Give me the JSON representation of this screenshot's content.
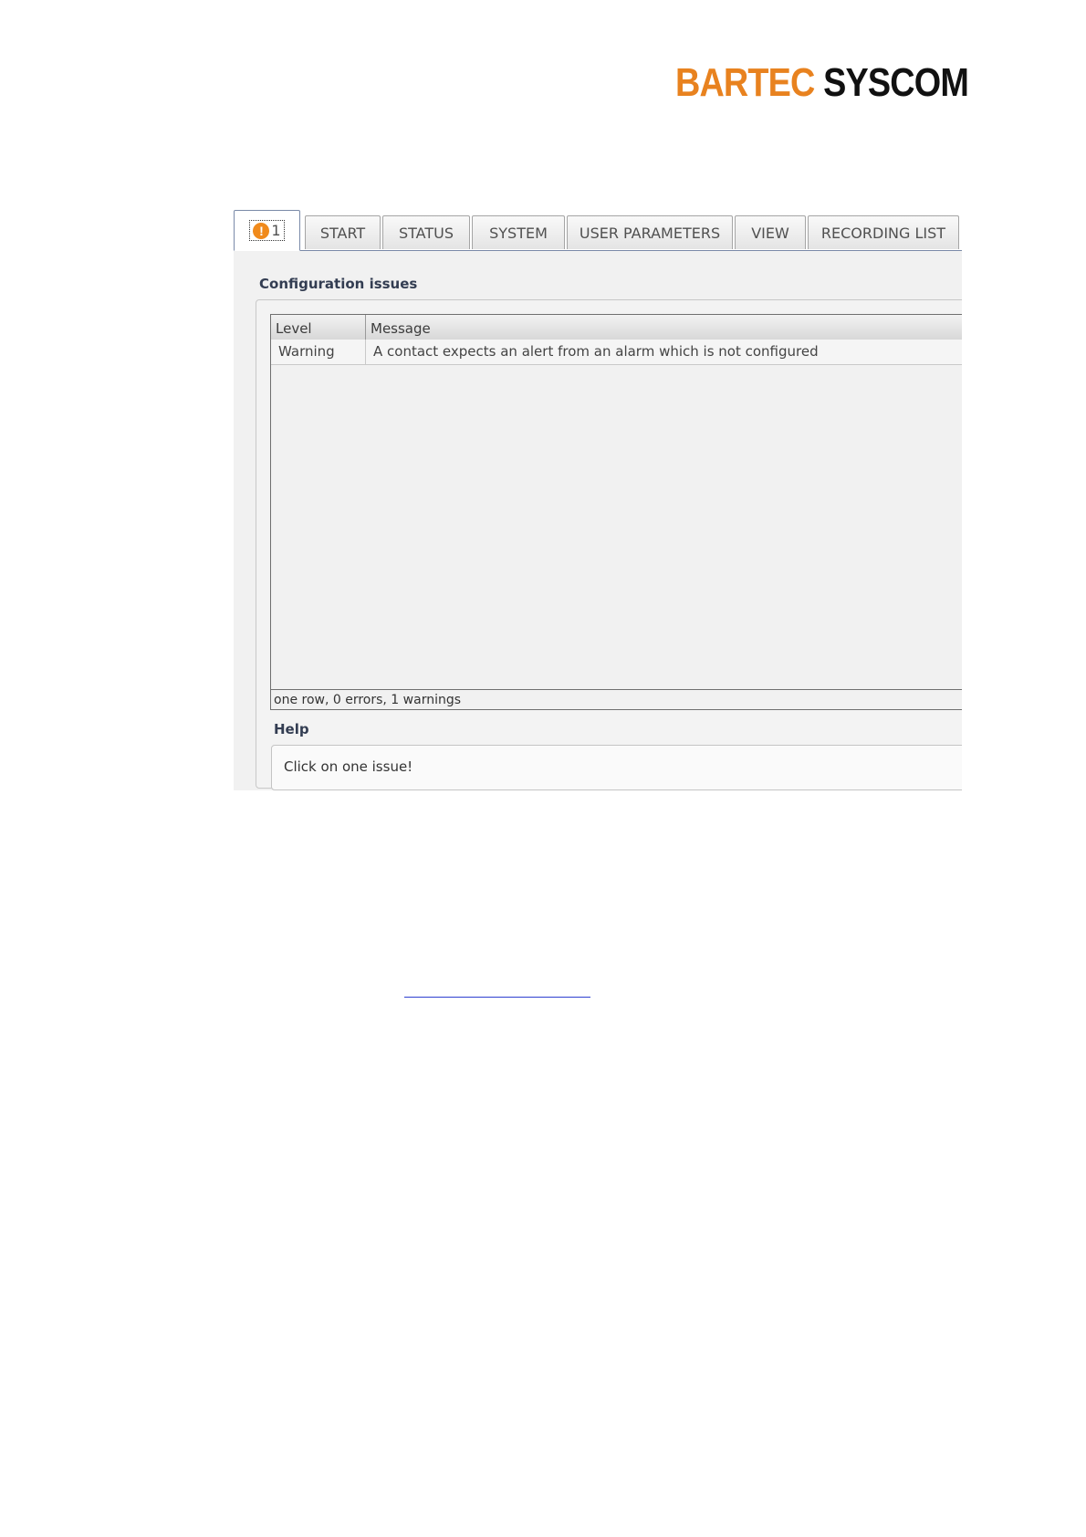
{
  "header": {
    "logo_part1": "BARTEC",
    "logo_part2": "SYSCOM"
  },
  "colors": {
    "brand_orange": "#e8821f",
    "warning_icon": "#f08a1c",
    "link_blue": "#2e3fd0"
  },
  "tabs": [
    {
      "label": "1",
      "icon": "warning-circle-icon",
      "active": true
    },
    {
      "label": "START"
    },
    {
      "label": "STATUS"
    },
    {
      "label": "SYSTEM"
    },
    {
      "label": "USER PARAMETERS"
    },
    {
      "label": "VIEW"
    },
    {
      "label": "RECORDING LIST"
    }
  ],
  "config_issues": {
    "title": "Configuration issues",
    "columns": [
      "Level",
      "Message"
    ],
    "rows": [
      {
        "level": "Warning",
        "message": "A contact expects an alert from an alarm which is not configured"
      }
    ],
    "footer": "one row, 0 errors, 1 warnings"
  },
  "help": {
    "title": "Help",
    "text": "Click on one issue!"
  }
}
